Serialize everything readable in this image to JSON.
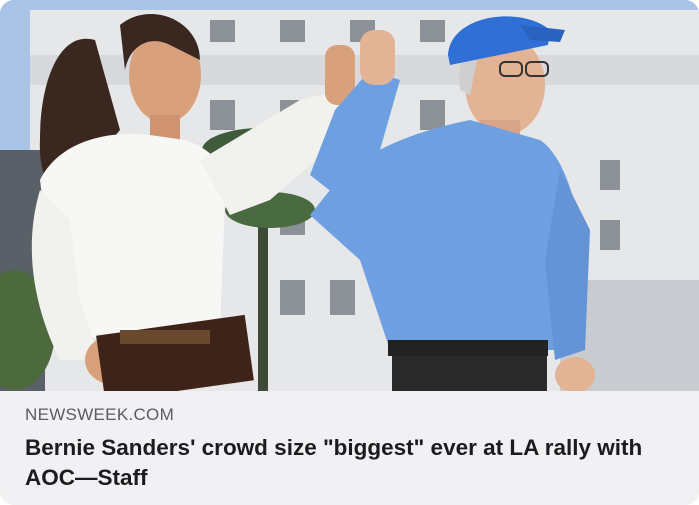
{
  "link_card": {
    "source": "NEWSWEEK.COM",
    "headline": "Bernie Sanders' crowd size \"biggest\" ever at LA rally with AOC—Staff",
    "image": {
      "subject": "photo-of-two-people-raising-joined-hands"
    }
  },
  "colors": {
    "footer_bg": "#f1f1f4",
    "source_text": "#5b5b60",
    "headline_text": "#1c1c1e",
    "sky": "#a9c4e6",
    "building": "#e6e7e9",
    "white_shirt": "#f7f7f5",
    "blue_shirt": "#6e9fe0",
    "cap": "#2f6fd6"
  }
}
